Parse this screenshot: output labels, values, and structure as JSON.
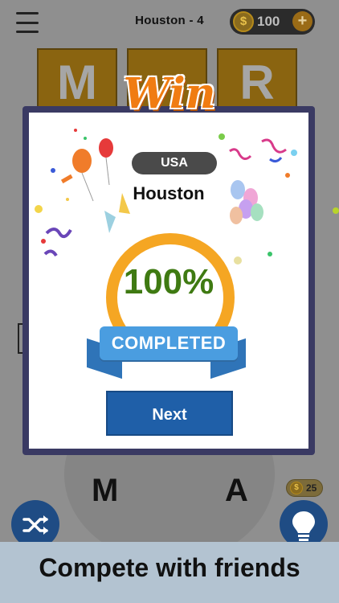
{
  "header": {
    "level_title": "Houston - 4",
    "coins": "100",
    "coin_symbol": "$",
    "add_coins_label": "+"
  },
  "answer_tiles": [
    "M",
    "",
    "R"
  ],
  "wheel_letters": [
    "M",
    "A"
  ],
  "hint_cost": {
    "symbol": "$",
    "value": "25"
  },
  "modal": {
    "badge_text": "Win",
    "country": "USA",
    "city": "Houston",
    "percent": "100%",
    "progress_fraction": 1.0,
    "ribbon_text": "COMPLETED",
    "next_label": "Next"
  },
  "banner": {
    "text": "Compete with friends"
  },
  "icons": {
    "menu": "menu-icon",
    "shuffle": "shuffle-icon",
    "hint": "lightbulb-icon"
  },
  "colors": {
    "accent_orange": "#f5a623",
    "button_blue": "#1f5fa8",
    "percent_green": "#3f7a12"
  }
}
